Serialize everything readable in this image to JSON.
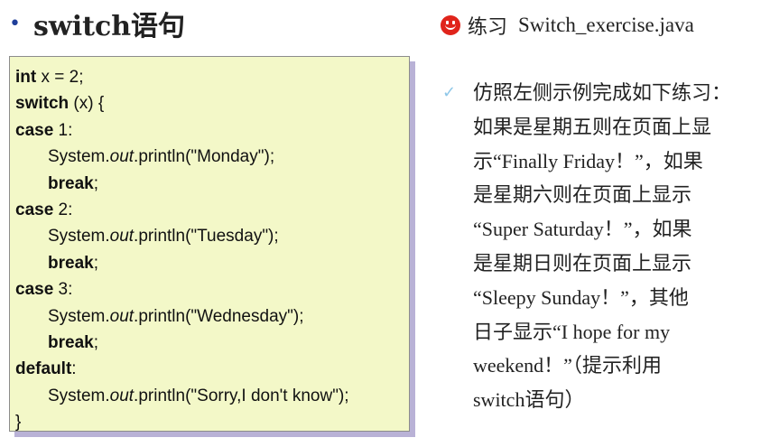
{
  "title": {
    "bullet": "•",
    "text": "switch语句"
  },
  "code": {
    "lines": [
      {
        "kw": "int",
        "rest": " x = 2;"
      },
      {
        "kw": "switch",
        "rest": " (x) {"
      },
      {
        "kw": "case",
        "rest": " 1:"
      },
      {
        "pre": "System.",
        "it": "out",
        "post": ".println(\"Monday\");"
      },
      {
        "kw": "break",
        "rest": ";"
      },
      {
        "kw": "case",
        "rest": " 2:"
      },
      {
        "pre": "System.",
        "it": "out",
        "post": ".println(\"Tuesday\");"
      },
      {
        "kw": "break",
        "rest": ";"
      },
      {
        "kw": "case",
        "rest": " 3:"
      },
      {
        "pre": "System.",
        "it": "out",
        "post": ".println(\"Wednesday\");"
      },
      {
        "kw": "break",
        "rest": ";"
      },
      {
        "kw": "default",
        "rest": ":"
      },
      {
        "pre": "System.",
        "it": "out",
        "post": ".println(\"Sorry,I don't know\");"
      },
      {
        "plain": "}"
      }
    ]
  },
  "exercise": {
    "icon": "smiley-icon",
    "label": "练习",
    "filename": "Switch_exercise.java",
    "check_symbol": "✓",
    "description_lines": [
      "仿照左侧示例完成如下练习：",
      "如果是星期五则在页面上显",
      "示“Finally Friday！”，如果",
      "是星期六则在页面上显示",
      "“Super Saturday！”，如果",
      "是星期日则在页面上显示",
      "“Sleepy Sunday！”，其他",
      "日子显示“I hope for my",
      "weekend！”（提示利用",
      "switch语句）"
    ]
  }
}
